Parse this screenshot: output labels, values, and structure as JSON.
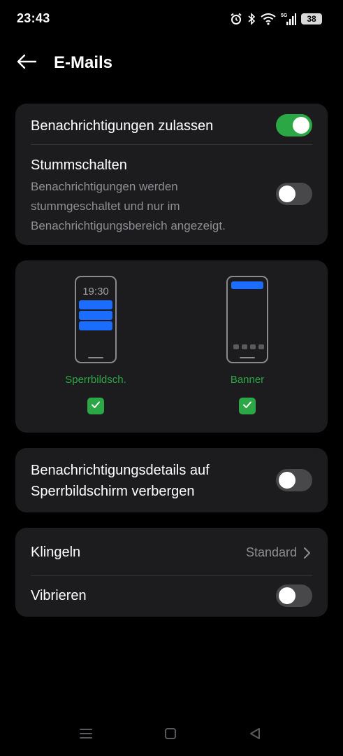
{
  "status_bar": {
    "time": "23:43",
    "battery": "38",
    "icons": [
      "alarm-icon",
      "bluetooth-icon",
      "wifi-icon",
      "5g-signal-icon",
      "battery-icon"
    ]
  },
  "header": {
    "title": "E-Mails",
    "back_icon": "arrow-left-icon"
  },
  "notifications_card": {
    "allow_label": "Benachrichtigungen zulassen",
    "allow_on": true,
    "mute_label": "Stummschalten",
    "mute_description": "Benachrichtigungen werden stummgeschaltet und nur im Benachrichtigungsbereich angezeigt.",
    "mute_on": false
  },
  "styles_card": {
    "lockscreen": {
      "preview_time": "19:30",
      "label": "Sperrbildsch.",
      "checked": true
    },
    "banner": {
      "label": "Banner",
      "checked": true
    }
  },
  "details_card": {
    "label": "Benachrichtigungsdetails auf Sperrbildschirm verbergen",
    "on": false
  },
  "sound_card": {
    "ringtone_label": "Klingeln",
    "ringtone_value": "Standard",
    "vibrate_label": "Vibrieren",
    "vibrate_on": false
  },
  "nav_bar": {
    "icons": [
      "menu-icon",
      "home-icon",
      "back-icon"
    ]
  },
  "colors": {
    "background": "#000000",
    "card": "#1c1c1e",
    "accent_green": "#2ca745",
    "notification_blue": "#1a6dff",
    "secondary_text": "#8e8e93"
  }
}
